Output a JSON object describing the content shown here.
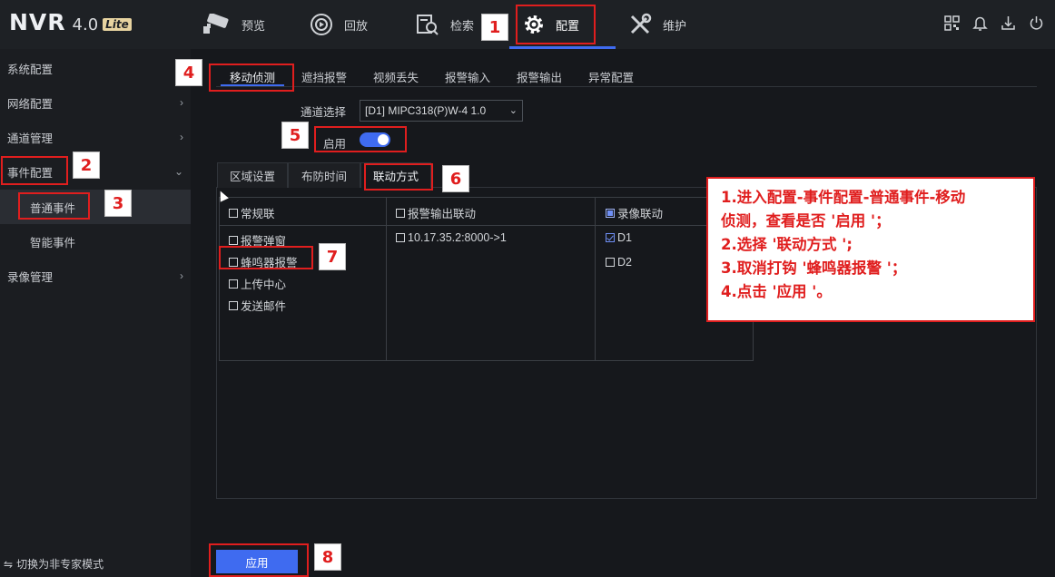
{
  "app": {
    "logo_main": "NVR",
    "logo_version": "4.0",
    "logo_badge": "Lite"
  },
  "topnav": {
    "items": [
      {
        "label": "预览",
        "icon": "camera-icon"
      },
      {
        "label": "回放",
        "icon": "playback-icon"
      },
      {
        "label": "检索",
        "icon": "search-file-icon"
      },
      {
        "label": "配置",
        "icon": "gear-icon"
      },
      {
        "label": "维护",
        "icon": "tools-icon"
      }
    ],
    "active": "配置",
    "right_icons": [
      "qr-icon",
      "bell-icon",
      "download-icon",
      "power-icon"
    ]
  },
  "sidebar": {
    "items": [
      {
        "label": "系统配置"
      },
      {
        "label": "网络配置"
      },
      {
        "label": "通道管理"
      },
      {
        "label": "事件配置"
      },
      {
        "label": "普通事件"
      },
      {
        "label": "智能事件"
      },
      {
        "label": "录像管理"
      }
    ],
    "footer": "切换为非专家模式"
  },
  "tabs": [
    "移动侦测",
    "遮挡报警",
    "视频丢失",
    "报警输入",
    "报警输出",
    "异常配置"
  ],
  "channel": {
    "label": "通道选择",
    "value": "[D1] MIPC318(P)W-4 1.0"
  },
  "enable": {
    "label": "启用",
    "on": true
  },
  "subtabs": [
    "区域设置",
    "布防时间",
    "联动方式"
  ],
  "linkage": {
    "col1_header": "常规联",
    "col2_header": "报警输出联动",
    "col3_header": "录像联动",
    "col1_items": [
      {
        "label": "报警弹窗",
        "checked": false
      },
      {
        "label": "蜂鸣器报警",
        "checked": false
      },
      {
        "label": "上传中心",
        "checked": false
      },
      {
        "label": "发送邮件",
        "checked": false
      }
    ],
    "col2_items": [
      {
        "label": "10.17.35.2:8000->1",
        "checked": false
      }
    ],
    "col3_items": [
      {
        "label": "D1",
        "checked": true
      },
      {
        "label": "D2",
        "checked": false
      }
    ]
  },
  "apply_label": "应用",
  "annotations": {
    "steps": [
      "1",
      "2",
      "3",
      "4",
      "5",
      "6",
      "7",
      "8"
    ],
    "note_lines": [
      "1.进入配置-事件配置-普通事件-移动",
      "侦测，查看是否 '启用 '；",
      "2.选择 '联动方式 ';",
      "3.取消打钩 '蜂鸣器报警 '；",
      "4.点击 '应用 '。"
    ]
  },
  "colors": {
    "accent": "#3f6bf0",
    "annotation": "#e01e1e"
  }
}
